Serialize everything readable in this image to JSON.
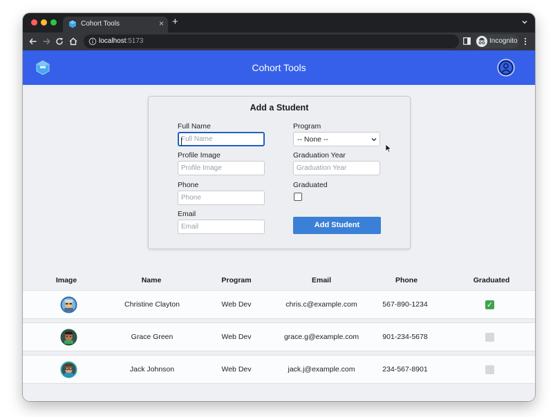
{
  "browser": {
    "tab_title": "Cohort Tools",
    "tab_close": "×",
    "new_tab": "+",
    "url_host": "localhost",
    "url_port": ":5173",
    "profile_label": "Incognito"
  },
  "header": {
    "title": "Cohort Tools"
  },
  "form": {
    "title": "Add a Student",
    "full_name": {
      "label": "Full Name",
      "placeholder": "Full Name"
    },
    "profile_image": {
      "label": "Profile Image",
      "placeholder": "Profile Image"
    },
    "phone": {
      "label": "Phone",
      "placeholder": "Phone"
    },
    "email": {
      "label": "Email",
      "placeholder": "Email"
    },
    "program": {
      "label": "Program",
      "selected": "-- None --"
    },
    "graduation_year": {
      "label": "Graduation Year",
      "placeholder": "Graduation Year"
    },
    "graduated": {
      "label": "Graduated",
      "checked": false
    },
    "submit_label": "Add Student"
  },
  "table": {
    "columns": [
      "Image",
      "Name",
      "Program",
      "Email",
      "Phone",
      "Graduated"
    ],
    "rows": [
      {
        "name": "Christine Clayton",
        "program": "Web Dev",
        "email": "chris.c@example.com",
        "phone": "567-890-1234",
        "graduated": true,
        "graduated_mark": "✓"
      },
      {
        "name": "Grace Green",
        "program": "Web Dev",
        "email": "grace.g@example.com",
        "phone": "901-234-5678",
        "graduated": false
      },
      {
        "name": "Jack Johnson",
        "program": "Web Dev",
        "email": "jack.j@example.com",
        "phone": "234-567-8901",
        "graduated": false
      }
    ]
  },
  "colors": {
    "header_bg": "#3660e9",
    "button_bg": "#3a80d6",
    "check_on": "#3fa34d"
  }
}
